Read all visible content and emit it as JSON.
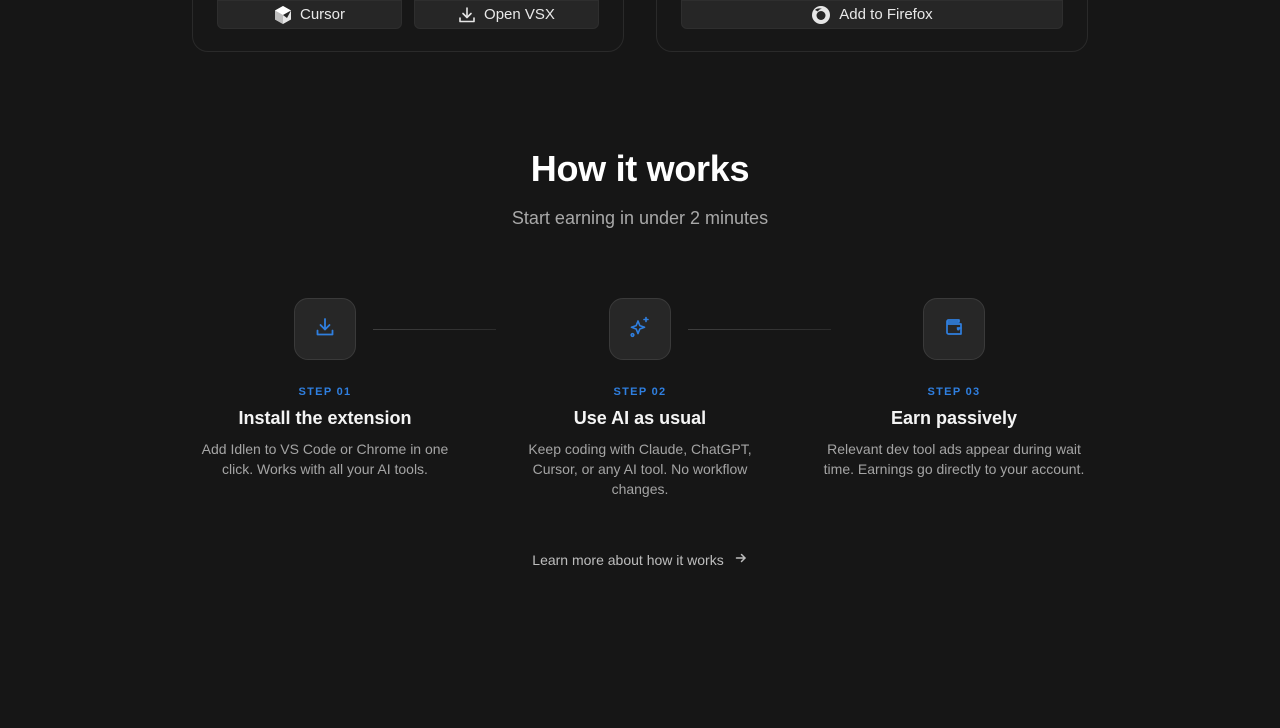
{
  "install_buttons": {
    "cursor_label": "Cursor",
    "openvsx_label": "Open VSX",
    "firefox_label": "Add to Firefox"
  },
  "how_it_works": {
    "title": "How it works",
    "subtitle": "Start earning in under 2 minutes",
    "steps": [
      {
        "label": "STEP 01",
        "title": "Install the extension",
        "description": "Add Idlen to VS Code or Chrome in one click. Works with all your AI tools.",
        "icon": "download-icon"
      },
      {
        "label": "STEP 02",
        "title": "Use AI as usual",
        "description": "Keep coding with Claude, ChatGPT, Cursor, or any AI tool. No workflow changes.",
        "icon": "sparkles-icon"
      },
      {
        "label": "STEP 03",
        "title": "Earn passively",
        "description": "Relevant dev tool ads appear during wait time. Earnings go directly to your account.",
        "icon": "wallet-icon"
      }
    ],
    "learn_more": "Learn more about how it works"
  },
  "colors": {
    "background": "#161616",
    "accent": "#2f7fe0",
    "muted_text": "#a4a4a4"
  }
}
